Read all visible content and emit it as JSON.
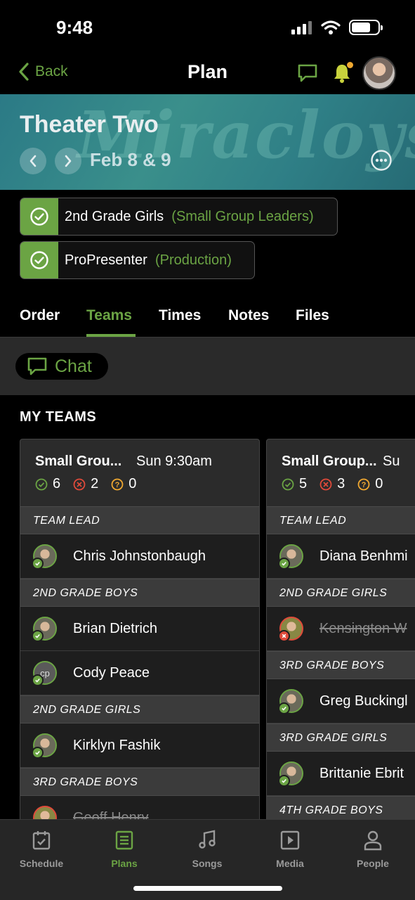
{
  "status": {
    "time": "9:48"
  },
  "nav": {
    "back_label": "Back",
    "title": "Plan"
  },
  "hero": {
    "title": "Theater Two",
    "date": "Feb 8 & 9",
    "art_text": "Miracloys"
  },
  "positions": [
    {
      "team": "2nd Grade Girls",
      "role": "(Small Group Leaders)"
    },
    {
      "team": "ProPresenter",
      "role": "(Production)"
    }
  ],
  "tabs": [
    "Order",
    "Teams",
    "Times",
    "Notes",
    "Files"
  ],
  "chat": {
    "label": "Chat"
  },
  "my_teams": {
    "heading": "MY TEAMS",
    "cards": [
      {
        "name": "Small Grou...",
        "time": "Sun 9:30am",
        "counts": {
          "confirmed": "6",
          "declined": "2",
          "unconfirmed": "0"
        },
        "sections": [
          {
            "title": "TEAM LEAD",
            "members": [
              {
                "name": "Chris Johnstonbaugh",
                "status": "confirmed"
              }
            ]
          },
          {
            "title": "2ND GRADE BOYS",
            "members": [
              {
                "name": "Brian Dietrich",
                "status": "confirmed"
              },
              {
                "name": "Cody Peace",
                "status": "confirmed",
                "initials": "cp"
              }
            ]
          },
          {
            "title": "2ND GRADE GIRLS",
            "members": [
              {
                "name": "Kirklyn Fashik",
                "status": "confirmed"
              }
            ]
          },
          {
            "title": "3RD GRADE BOYS",
            "members": [
              {
                "name": "Geoff Henry",
                "status": "declined"
              }
            ]
          }
        ]
      },
      {
        "name": "Small Group...",
        "time": "Su",
        "counts": {
          "confirmed": "5",
          "declined": "3",
          "unconfirmed": "0"
        },
        "sections": [
          {
            "title": "TEAM LEAD",
            "members": [
              {
                "name": "Diana Benhmi",
                "status": "confirmed"
              }
            ]
          },
          {
            "title": "2ND GRADE GIRLS",
            "members": [
              {
                "name": "Kensington W",
                "status": "declined"
              }
            ]
          },
          {
            "title": "3RD GRADE BOYS",
            "members": [
              {
                "name": "Greg Buckingl",
                "status": "confirmed"
              }
            ]
          },
          {
            "title": "3RD GRADE GIRLS",
            "members": [
              {
                "name": "Brittanie Ebrit",
                "status": "confirmed"
              }
            ]
          },
          {
            "title": "4TH GRADE BOYS",
            "members": []
          }
        ]
      }
    ]
  },
  "bottom_tabs": [
    {
      "label": "Schedule",
      "icon": "calendar-icon"
    },
    {
      "label": "Plans",
      "icon": "plans-icon",
      "active": true
    },
    {
      "label": "Songs",
      "icon": "music-note-icon"
    },
    {
      "label": "Media",
      "icon": "media-play-icon"
    },
    {
      "label": "People",
      "icon": "person-icon"
    }
  ],
  "colors": {
    "accent": "#6ba444",
    "declined": "#e04a3a",
    "unconfirmed": "#f0a830",
    "bell": "#c8d23c"
  }
}
